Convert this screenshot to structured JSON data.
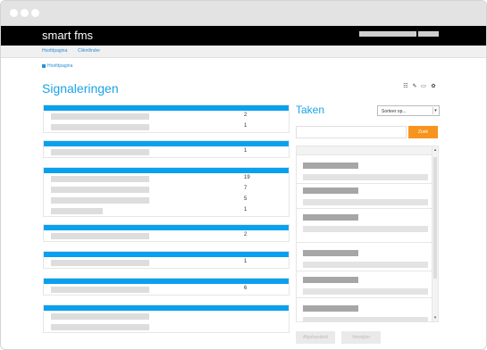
{
  "window": {
    "dots": 3
  },
  "header": {
    "brand": "smart fms"
  },
  "nav": {
    "items": [
      "Hoofdpagina",
      "Cliëntlinder"
    ]
  },
  "breadcrumb": {
    "label": "Hoofdpagina"
  },
  "page": {
    "title": "Signaleringen"
  },
  "toolbar": {
    "icons": [
      "list-icon",
      "edit-icon",
      "comment-icon",
      "gear-icon"
    ]
  },
  "signal_groups": [
    {
      "rows": [
        {
          "count": "2"
        },
        {
          "count": "1"
        }
      ]
    },
    {
      "rows": [
        {
          "count": "1"
        }
      ]
    },
    {
      "rows": [
        {
          "count": "19"
        },
        {
          "count": "7"
        },
        {
          "count": "5"
        },
        {
          "count": "1"
        }
      ]
    },
    {
      "rows": [
        {
          "count": "2"
        }
      ]
    },
    {
      "rows": [
        {
          "count": "1"
        }
      ]
    },
    {
      "rows": [
        {
          "count": "6"
        }
      ]
    },
    {
      "rows": [
        {
          "count": ""
        },
        {
          "count": ""
        }
      ]
    }
  ],
  "tasks": {
    "title": "Taken",
    "sort_placeholder": "Sorteer op...",
    "search_button": "Zoek"
  },
  "footer_buttons": {
    "first": "Afgehandeld",
    "second": "Verwijder"
  }
}
